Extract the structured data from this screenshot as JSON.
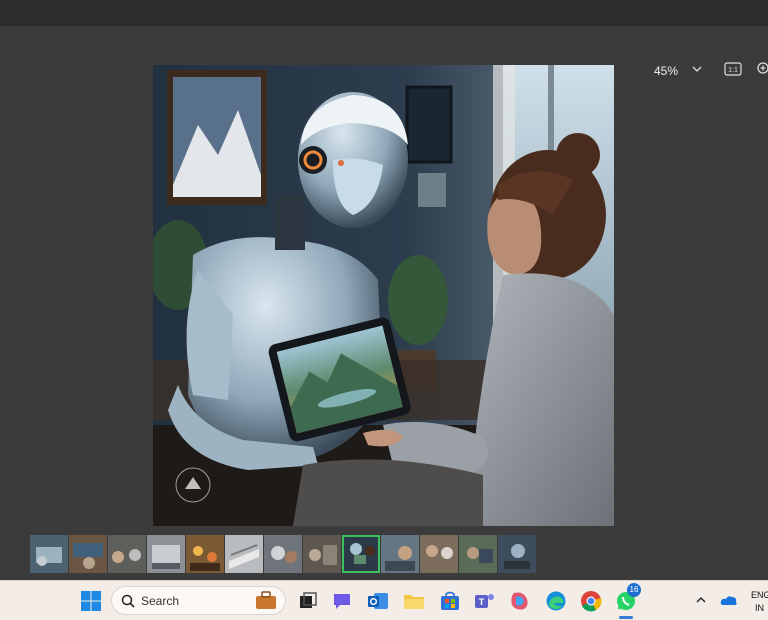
{
  "toolbar": {
    "zoom_level": "45%",
    "fit_label": "1:1"
  },
  "image": {
    "content": "humanoid robot showing a tablet with a landscape painting to a woman"
  },
  "filmstrip": {
    "thumbnails": [
      "thumb-1",
      "thumb-2",
      "thumb-3",
      "thumb-4",
      "thumb-5",
      "thumb-6",
      "thumb-7",
      "thumb-8",
      "thumb-9",
      "thumb-10",
      "thumb-11",
      "thumb-12",
      "thumb-13"
    ],
    "selected_index": 8
  },
  "taskbar": {
    "search_placeholder": "Search",
    "whatsapp_badge": "16",
    "language_top": "ENG",
    "language_bottom": "IN"
  },
  "colors": {
    "selected_thumb_border": "#3bbf5c",
    "badge": "#1f6fd1"
  }
}
